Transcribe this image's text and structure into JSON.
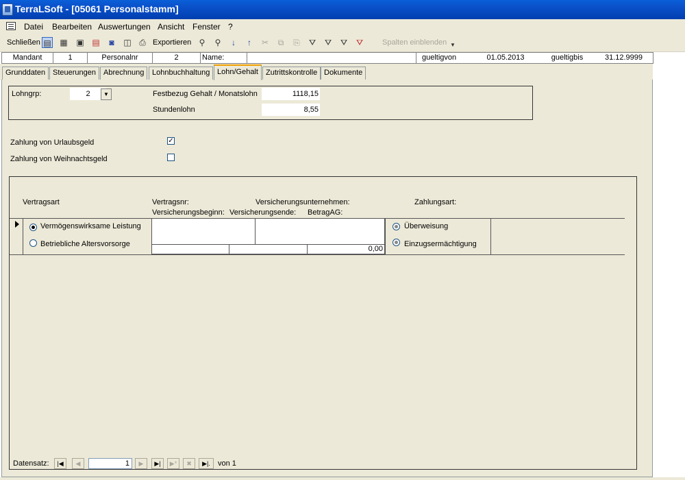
{
  "window": {
    "title": "TerraLSoft - [05061 Personalstamm]"
  },
  "menu": {
    "items": [
      "Datei",
      "Bearbeiten",
      "Auswertungen",
      "Ansicht",
      "Fenster",
      "?"
    ]
  },
  "toolbar": {
    "close_label": "Schließen",
    "export_label": "Exportieren",
    "show_columns_label": "Spalten einblenden"
  },
  "header": {
    "mandant_label": "Mandant",
    "mandant_value": "1",
    "personalnr_label": "Personalnr",
    "personalnr_value": "2",
    "name_label": "Name:",
    "name_value": "",
    "gueltigvon_label": "gueltigvon",
    "gueltigvon_value": "01.05.2013",
    "gueltigbis_label": "gueltigbis",
    "gueltigbis_value": "31.12.9999"
  },
  "tabs": [
    "Grunddaten",
    "Steuerungen",
    "Abrechnung",
    "Lohnbuchhaltung",
    "Lohn/Gehalt",
    "Zutrittskontrolle",
    "Dokumente"
  ],
  "active_tab": "Lohn/Gehalt",
  "form": {
    "lohngrp_label": "Lohngrp:",
    "lohngrp_value": "2",
    "festbezug_label": "Festbezug Gehalt / Monatslohn",
    "festbezug_value": "1118,15",
    "stundenlohn_label": "Stundenlohn",
    "stundenlohn_value": "8,55",
    "urlaubsgeld_label": "Zahlung von Urlaubsgeld",
    "urlaubsgeld_checked": true,
    "weihnachtsgeld_label": "Zahlung von Weihnachtsgeld",
    "weihnachtsgeld_checked": false
  },
  "contracts": {
    "col_vertragsart": "Vertragsart",
    "col_vertragsnr": "Vertragsnr:",
    "col_versicherungsunternehmen": "Versicherungsunternehmen:",
    "col_zahlungsart": "Zahlungsart:",
    "col_versicherungsbeginn": "Versicherungsbeginn:",
    "col_versicherungsende": "Versicherungsende:",
    "col_betragag": "BetragAG:",
    "option_vwl": "Vermögenswirksame Leistung",
    "option_bav": "Betriebliche Altersvorsorge",
    "option_ueberweisung": "Überweisung",
    "option_einzug": "Einzugsermächtigung",
    "betragag_value": "0,00"
  },
  "navigation": {
    "label": "Datensatz:",
    "current": "1",
    "of_label": "von 1"
  },
  "colors": {
    "titlebar": "#0a4fc8",
    "face": "#ece9d8",
    "active_tab_accent": "#f0a000"
  }
}
